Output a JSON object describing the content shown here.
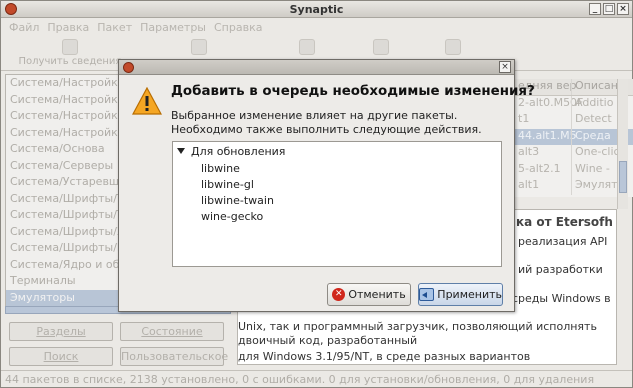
{
  "window": {
    "title": "Synaptic"
  },
  "menu": [
    "Файл",
    "Правка",
    "Пакет",
    "Параметры",
    "Справка"
  ],
  "toolbar": {
    "reload_label": "Получить сведения"
  },
  "sidebar": {
    "items": [
      "Система/Настройка/",
      "Система/Настройка/",
      "Система/Настройка/",
      "Система/Настройка/",
      "Система/Основа",
      "Система/Серверы",
      "Система/Устаревшие",
      "Система/Шрифты/Тр",
      "Система/Шрифты/Ту",
      "Система/Шрифты/X1",
      "Система/Шрифты/Ко",
      "Система/Ядро и обор",
      "Терминалы",
      "Эмуляторы"
    ],
    "selected": "Эмуляторы"
  },
  "side_buttons": {
    "sections": "Разделы",
    "status": "Состояние",
    "search": "Поиск",
    "custom": "Пользовательское"
  },
  "table": {
    "headers": [
      "едняя вер",
      "Описан"
    ],
    "rows": [
      [
        "2-alt0.M50F",
        "Additio"
      ],
      [
        "t1",
        "Detect"
      ],
      [
        "44.alt1.M5",
        "Среда"
      ],
      [
        "alt3",
        "One-clic"
      ],
      [
        "5-alt2.1",
        "Wine - "
      ],
      [
        "alt1",
        "Эмулят"
      ]
    ],
    "selected_row": 2
  },
  "description": {
    "title": "ка от Etersofh",
    "lines": [
      "реализация API",
      "ий разработки",
      "среды Windows в",
      "Unix, так и программный загрузчик, позволяющий исполнять",
      "двоичный код, разработанный",
      "для Windows 3.1/95/NT, в среде разных вариантов"
    ]
  },
  "status_bar": "44 пакетов в списке, 2138 установлено, 0 с ошибками. 0 для установки/обновления, 0 для удаления",
  "dialog": {
    "heading": "Добавить в очередь необходимые изменения?",
    "message_line1": "Выбранное изменение влияет на другие пакеты.",
    "message_line2": "Необходимо также выполнить следующие действия.",
    "group_label": "Для обновления",
    "packages": [
      "libwine",
      "libwine-gl",
      "libwine-twain",
      "wine-gecko"
    ],
    "cancel_label": "Отменить",
    "apply_label": "Применить"
  },
  "colors": {
    "selection": "#b8c5d6",
    "warning": "#f5a623",
    "cancel_icon": "#d0271c"
  }
}
